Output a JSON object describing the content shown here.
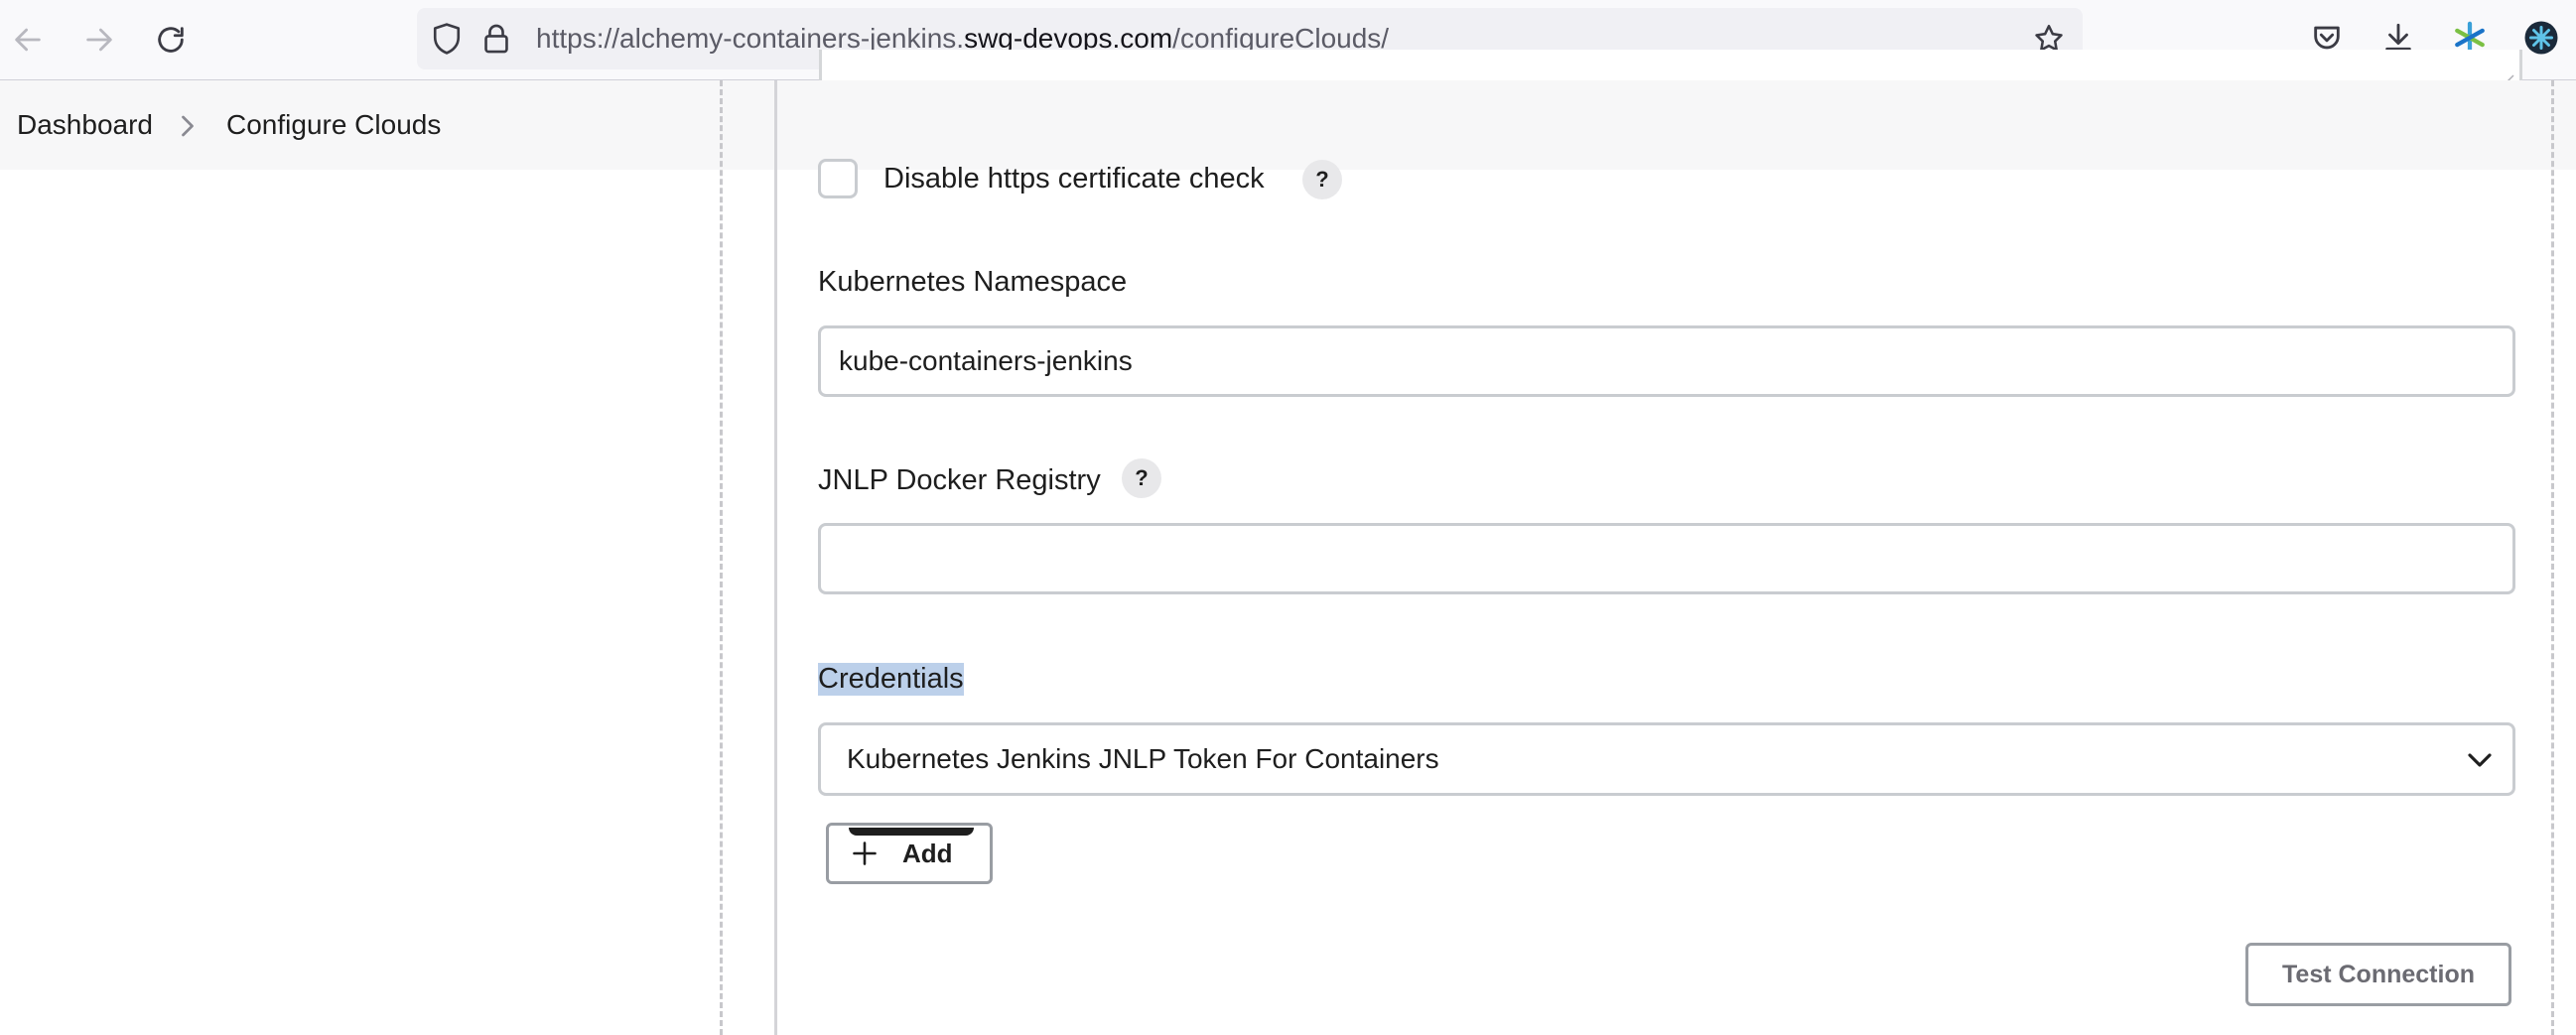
{
  "browser": {
    "url_prefix": "https://alchemy-containers-jenkins.",
    "url_domain": "swg-devops.com",
    "url_path": "/configureClouds/",
    "icons": [
      "back-icon",
      "forward-icon",
      "reload-icon",
      "shield-icon",
      "lock-icon",
      "star-icon",
      "pocket-icon",
      "download-icon",
      "extension-icon",
      "profile-icon"
    ]
  },
  "breadcrumb": {
    "items": [
      {
        "label": "Dashboard"
      },
      {
        "label": "Configure Clouds"
      }
    ]
  },
  "form": {
    "disable_https_label": "Disable https certificate check",
    "disable_https_checked": false,
    "namespace": {
      "label": "Kubernetes Namespace",
      "value": "kube-containers-jenkins"
    },
    "jnlp_registry": {
      "label": "JNLP Docker Registry",
      "value": ""
    },
    "credentials": {
      "label": "Credentials",
      "selected": "Kubernetes Jenkins JNLP Token For Containers"
    },
    "help_label": "?",
    "add_button": "Add",
    "test_button": "Test Connection"
  }
}
